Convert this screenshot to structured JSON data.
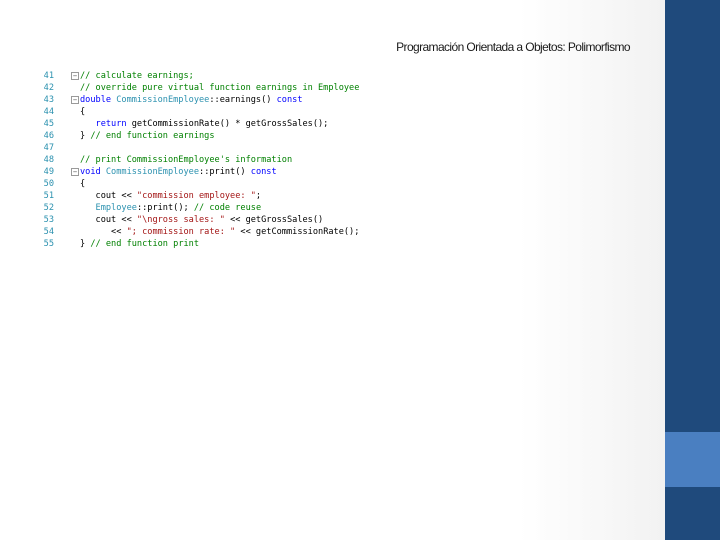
{
  "slide": {
    "title": "Programación Orientada a Objetos: Polimorfismo"
  },
  "colors": {
    "right_bar": "#1f4a7c",
    "right_bar_accent": "#4a7fc1",
    "comment": "#008000",
    "keyword": "#0000ff",
    "type": "#2b91af",
    "string": "#a31515",
    "line_number": "#2b91af"
  },
  "code": {
    "fold_icon": "minus-box",
    "lines": [
      {
        "num": "41",
        "fold": true,
        "tokens": [
          {
            "c": "cm",
            "t": "// calculate earnings;"
          }
        ]
      },
      {
        "num": "42",
        "fold": false,
        "tokens": [
          {
            "c": "cm",
            "t": "// override pure virtual function earnings in Employee"
          }
        ]
      },
      {
        "num": "43",
        "fold": true,
        "tokens": [
          {
            "c": "kw",
            "t": "double "
          },
          {
            "c": "ty",
            "t": "CommissionEmployee"
          },
          {
            "c": "pl",
            "t": "::earnings() "
          },
          {
            "c": "kw",
            "t": "const"
          }
        ]
      },
      {
        "num": "44",
        "fold": false,
        "tokens": [
          {
            "c": "pl",
            "t": "{"
          }
        ]
      },
      {
        "num": "45",
        "fold": false,
        "tokens": [
          {
            "c": "pl",
            "t": "   "
          },
          {
            "c": "kw",
            "t": "return "
          },
          {
            "c": "pl",
            "t": "getCommissionRate() * getGrossSales();"
          }
        ]
      },
      {
        "num": "46",
        "fold": false,
        "tokens": [
          {
            "c": "pl",
            "t": "} "
          },
          {
            "c": "cm",
            "t": "// end function earnings"
          }
        ]
      },
      {
        "num": "47",
        "fold": false,
        "tokens": []
      },
      {
        "num": "48",
        "fold": false,
        "tokens": [
          {
            "c": "cm",
            "t": "// print CommissionEmployee's information"
          }
        ]
      },
      {
        "num": "49",
        "fold": true,
        "tokens": [
          {
            "c": "kw",
            "t": "void "
          },
          {
            "c": "ty",
            "t": "CommissionEmployee"
          },
          {
            "c": "pl",
            "t": "::print() "
          },
          {
            "c": "kw",
            "t": "const"
          }
        ]
      },
      {
        "num": "50",
        "fold": false,
        "tokens": [
          {
            "c": "pl",
            "t": "{"
          }
        ]
      },
      {
        "num": "51",
        "fold": false,
        "tokens": [
          {
            "c": "pl",
            "t": "   cout << "
          },
          {
            "c": "st",
            "t": "\"commission employee: \""
          },
          {
            "c": "pl",
            "t": ";"
          }
        ]
      },
      {
        "num": "52",
        "fold": false,
        "tokens": [
          {
            "c": "pl",
            "t": "   "
          },
          {
            "c": "ty",
            "t": "Employee"
          },
          {
            "c": "pl",
            "t": "::print(); "
          },
          {
            "c": "cm",
            "t": "// code reuse"
          }
        ]
      },
      {
        "num": "53",
        "fold": false,
        "tokens": [
          {
            "c": "pl",
            "t": "   cout << "
          },
          {
            "c": "st",
            "t": "\"\\ngross sales: \""
          },
          {
            "c": "pl",
            "t": " << getGrossSales()"
          }
        ]
      },
      {
        "num": "54",
        "fold": false,
        "tokens": [
          {
            "c": "pl",
            "t": "      << "
          },
          {
            "c": "st",
            "t": "\"; commission rate: \""
          },
          {
            "c": "pl",
            "t": " << getCommissionRate();"
          }
        ]
      },
      {
        "num": "55",
        "fold": false,
        "tokens": [
          {
            "c": "pl",
            "t": "} "
          },
          {
            "c": "cm",
            "t": "// end function print"
          }
        ]
      }
    ]
  }
}
